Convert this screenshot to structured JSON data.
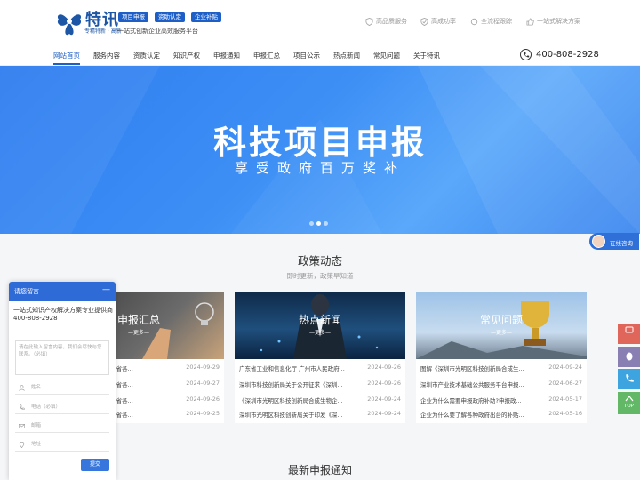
{
  "header": {
    "brand_name": "特讯",
    "brand_sub": "专精特新 · 高新",
    "tags": [
      "项目申报",
      "资助认定",
      "企业补贴"
    ],
    "slogan": "一站式创新企业高效服务平台",
    "features": [
      {
        "label": "高品质服务",
        "icon": "shield-check-icon"
      },
      {
        "label": "高成功率",
        "icon": "shield-icon"
      },
      {
        "label": "全流程跟踪",
        "icon": "refresh-icon"
      },
      {
        "label": "一站式解决方案",
        "icon": "thumbs-up-icon"
      }
    ]
  },
  "nav": {
    "items": [
      "网站首页",
      "服务内容",
      "资质认定",
      "知识产权",
      "申报通知",
      "申报汇总",
      "项目公示",
      "热点新闻",
      "常见问题",
      "关于特讯"
    ],
    "active_index": 0,
    "phone": "400-808-2928"
  },
  "banner": {
    "title": "科技项目申报",
    "subtitle": "享受政府百万奖补",
    "slide_count": 3,
    "active_slide": 1
  },
  "policy": {
    "title": "政策动态",
    "subtitle": "即时更新，政策早知道",
    "cards": [
      {
        "title": "申报汇总",
        "more": "—更多—",
        "rows": [
          {
            "title": "2024年09月29日广东省各...",
            "date": "2024-09-29"
          },
          {
            "title": "2024年09月27日广东省各...",
            "date": "2024-09-27"
          },
          {
            "title": "2024年09月26日广东省各...",
            "date": "2024-09-26"
          },
          {
            "title": "2024年09月25日广东省各...",
            "date": "2024-09-25"
          }
        ]
      },
      {
        "title": "热点新闻",
        "more": "—更多—",
        "rows": [
          {
            "title": "广东省工业和信息化厅 广州市人民政府...",
            "date": "2024-09-26"
          },
          {
            "title": "深圳市科技创新局关于公开征求《深圳...",
            "date": "2024-09-26"
          },
          {
            "title": "《深圳市光明区科技创新局合成生物企...",
            "date": "2024-09-24"
          },
          {
            "title": "深圳市光明区科技创新局关于印发《深...",
            "date": "2024-09-24"
          }
        ]
      },
      {
        "title": "常见问题",
        "more": "—更多—",
        "rows": [
          {
            "title": "图解《深圳市光明区科技创新局合成生...",
            "date": "2024-09-24"
          },
          {
            "title": "深圳市产业技术基础公共服务平台申报...",
            "date": "2024-06-27"
          },
          {
            "title": "企业为什么需要申报政府补助?申报政...",
            "date": "2024-05-17"
          },
          {
            "title": "企业为什么要了解各种政府出台的补贴...",
            "date": "2024-05-16"
          }
        ]
      }
    ]
  },
  "notice_title": "最新申报通知",
  "float": {
    "online_label": "在线咨询",
    "side_buttons": [
      {
        "label": "资讯\n咨询",
        "icon": "consult-icon",
        "color": "#e0665b"
      },
      {
        "label": "",
        "icon": "qq-icon",
        "color": "#8a7fb3"
      },
      {
        "label": "",
        "icon": "phone-icon",
        "color": "#3ea4df"
      },
      {
        "label": "TOP",
        "icon": "arrow-up-icon",
        "color": "#62b866"
      }
    ]
  },
  "chat": {
    "title": "请您留言",
    "intro": "一站式知识产权解决方案专业提供商",
    "phone": "400-808-2928",
    "message_placeholder": "请在此输入留言内容，我们会尽快与您联系。（必填）",
    "fields": [
      {
        "placeholder": "姓名",
        "icon": "user-icon"
      },
      {
        "placeholder": "电话（必填）",
        "icon": "phone-icon"
      },
      {
        "placeholder": "邮箱",
        "icon": "mail-icon"
      },
      {
        "placeholder": "地址",
        "icon": "location-icon"
      }
    ],
    "submit": "提交"
  }
}
